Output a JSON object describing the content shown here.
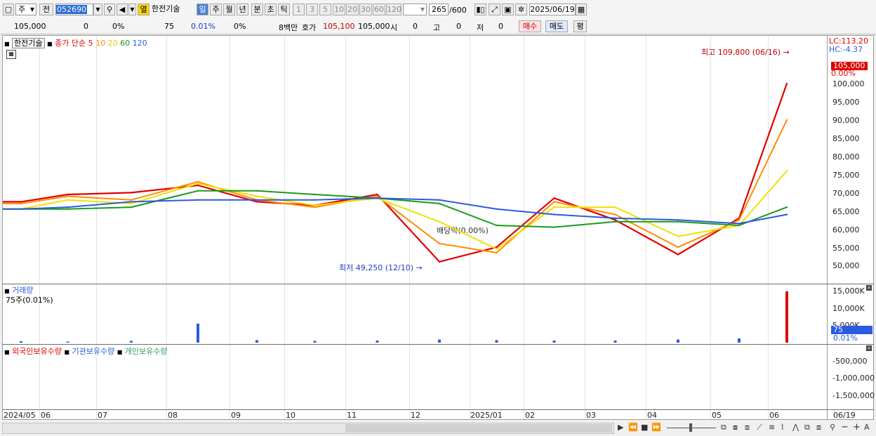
{
  "toolbar": {
    "market": "주",
    "prev_label": "전",
    "stock_code": "052690",
    "open_label": "열",
    "stock_name": "한전기술",
    "periods": [
      "일",
      "주",
      "월",
      "년",
      "분",
      "초",
      "틱"
    ],
    "active_period": "일",
    "intervals": [
      "1",
      "3",
      "5",
      "10",
      "20",
      "30",
      "60",
      "120"
    ],
    "count": "265",
    "count_total": "/600",
    "date": "2025/06/19"
  },
  "infobar": {
    "price": "105,000",
    "change": "0",
    "change_pct": "0%",
    "volume": "75",
    "volume_pct": "0.01%",
    "turnover_pct": "0%",
    "amount": "8백만",
    "bid_label": "호가",
    "bid": "105,100",
    "ask": "105,000",
    "open_label": "시",
    "open": "0",
    "high_label": "고",
    "high": "0",
    "low_label": "저",
    "low": "0",
    "buy_label": "매수",
    "sell_label": "매도",
    "avg_label": "평"
  },
  "price_panel": {
    "stock_tag": "한전기술",
    "ma_label": "종가 단순",
    "ma_periods": [
      "5",
      "10",
      "20",
      "60",
      "120"
    ],
    "ma_colors": [
      "#e00000",
      "#ff8c00",
      "#f0e000",
      "#1a9a1a",
      "#2a5be0"
    ],
    "lc_label": "LC:113.20",
    "hc_label": "HC:-4.37",
    "current_tag": "105,000",
    "current_pct": "0.00%",
    "high_note": "최고 109,800 (06/16)",
    "low_note": "최저 49,250 (12/10)",
    "dividend_note": "배당락(0.00%)",
    "y_ticks": [
      "100,000",
      "95,000",
      "90,000",
      "85,000",
      "80,000",
      "75,000",
      "70,000",
      "65,000",
      "60,000",
      "55,000",
      "50,000"
    ]
  },
  "volume_panel": {
    "title": "거래량",
    "subtitle": "75주(0.01%)",
    "y_ticks": [
      "15,000K",
      "10,000K",
      "5,000K"
    ],
    "current_tag": "75",
    "current_pct": "0.01%"
  },
  "holding_panel": {
    "foreign_label": "외국인보유수량",
    "inst_label": "기관보유수량",
    "indiv_label": "개인보유수량",
    "colors": [
      "#e00000",
      "#2a5be0",
      "#2e9a5a"
    ],
    "y_ticks": [
      "-500,000",
      "-1,000,000",
      "-1,500,000"
    ]
  },
  "x_axis": {
    "ticks": [
      "2024/05",
      "06",
      "07",
      "08",
      "09",
      "10",
      "11",
      "12",
      "2025/01",
      "02",
      "03",
      "04",
      "05",
      "06",
      "06/19"
    ]
  },
  "chart_data": {
    "type": "line",
    "title": "한전기술",
    "x": [
      "2024/05",
      "06",
      "07",
      "08",
      "09",
      "10",
      "11",
      "12",
      "2025/01",
      "02",
      "03",
      "04",
      "05",
      "06"
    ],
    "ylim": [
      46000,
      113200
    ],
    "series": [
      {
        "name": "5",
        "values": [
          67500,
          69500,
          70000,
          72000,
          67500,
          66500,
          69500,
          51000,
          55000,
          68500,
          62500,
          53000,
          63000,
          100000
        ]
      },
      {
        "name": "10",
        "values": [
          67000,
          69000,
          68000,
          73000,
          68000,
          66000,
          69000,
          56000,
          53500,
          67500,
          64000,
          55000,
          62500,
          90000
        ]
      },
      {
        "name": "20",
        "values": [
          65500,
          68000,
          67000,
          72500,
          69000,
          66500,
          68500,
          62000,
          54500,
          66000,
          66000,
          58000,
          61000,
          76000
        ]
      },
      {
        "name": "60",
        "values": [
          65500,
          65500,
          66000,
          70500,
          70500,
          69500,
          68500,
          67000,
          61000,
          60500,
          62000,
          62000,
          61000,
          66000
        ]
      },
      {
        "name": "120",
        "values": [
          65500,
          66000,
          67500,
          68000,
          68000,
          68000,
          68500,
          68000,
          65500,
          64000,
          63000,
          62500,
          61500,
          64000
        ]
      }
    ],
    "volume_values_k": [
      400,
      300,
      500,
      5500,
      700,
      500,
      600,
      900,
      700,
      600,
      600,
      900,
      1200,
      14800
    ]
  }
}
